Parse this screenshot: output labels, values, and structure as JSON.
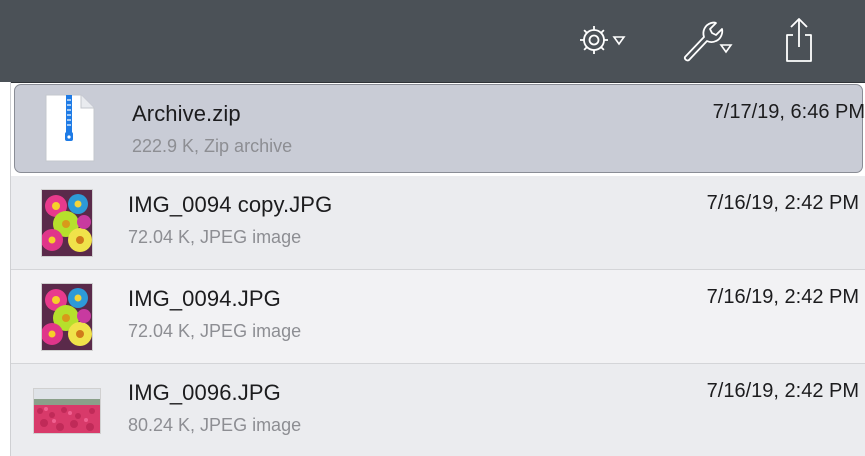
{
  "toolbar": {
    "buttons": [
      {
        "icon": "gear-icon",
        "menu": true
      },
      {
        "icon": "wrench-icon",
        "menu": true
      },
      {
        "icon": "share-icon",
        "menu": false
      }
    ]
  },
  "files": [
    {
      "name": "Archive.zip",
      "meta": "222.9 K, Zip archive",
      "date": "7/17/19, 6:46 PM",
      "kind": "zip",
      "selected": true
    },
    {
      "name": "IMG_0094 copy.JPG",
      "meta": "72.04 K, JPEG image",
      "date": "7/16/19, 2:42 PM",
      "kind": "jpeg-flowers"
    },
    {
      "name": "IMG_0094.JPG",
      "meta": "72.04 K, JPEG image",
      "date": "7/16/19, 2:42 PM",
      "kind": "jpeg-flowers"
    },
    {
      "name": "IMG_0096.JPG",
      "meta": "80.24 K, JPEG image",
      "date": "7/16/19, 2:42 PM",
      "kind": "jpeg-tulips"
    }
  ],
  "colors": {
    "toolbar_bg": "#4b5157",
    "selected_row": "#c9ccd6",
    "alt_row": "#ebecef",
    "icon_white": "#ffffff",
    "zip_blue": "#1e7be6"
  }
}
